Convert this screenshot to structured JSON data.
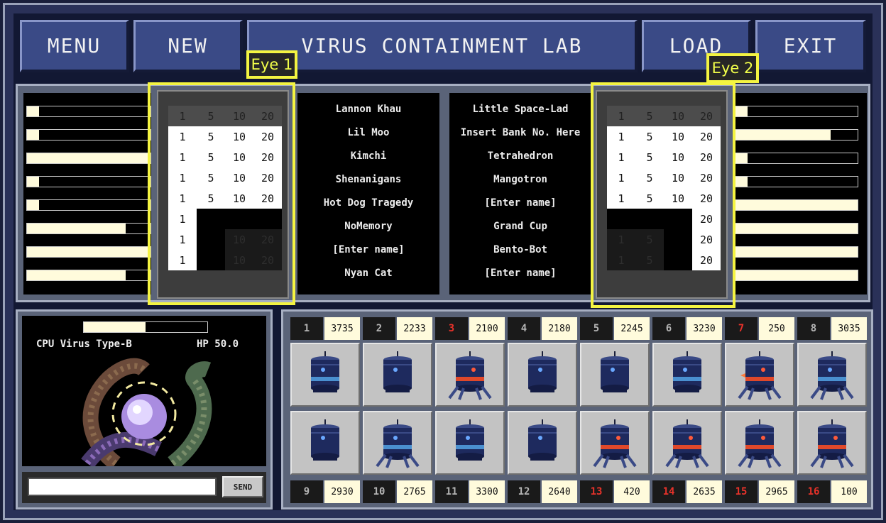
{
  "toolbar": {
    "menu_label": "MENU",
    "new_label": "NEW",
    "title": "VIRUS CONTAINMENT LAB",
    "load_label": "LOAD",
    "exit_label": "EXIT"
  },
  "annotations": {
    "eye1": "Eye 1",
    "eye2": "Eye 2"
  },
  "eye1_grid": {
    "header": [
      "1",
      "5",
      "10",
      "20"
    ],
    "rows": [
      [
        "1",
        "5",
        "10",
        "20"
      ],
      [
        "1",
        "5",
        "10",
        "20"
      ],
      [
        "1",
        "5",
        "10",
        "20"
      ],
      [
        "1",
        "5",
        "10",
        "20"
      ],
      [
        "1",
        "",
        "",
        ""
      ],
      [
        "1",
        "",
        "10",
        "20"
      ],
      [
        "1",
        "",
        "10",
        "20"
      ]
    ]
  },
  "eye2_grid": {
    "header": [
      "1",
      "5",
      "10",
      "20"
    ],
    "rows": [
      [
        "1",
        "5",
        "10",
        "20"
      ],
      [
        "1",
        "5",
        "10",
        "20"
      ],
      [
        "1",
        "5",
        "10",
        "20"
      ],
      [
        "1",
        "5",
        "10",
        "20"
      ],
      [
        "",
        "",
        "",
        "20"
      ],
      [
        "1",
        "5",
        "",
        "20"
      ],
      [
        "1",
        "5",
        "",
        "20"
      ]
    ]
  },
  "left_bars": [
    0.1,
    0.1,
    1.0,
    0.1,
    0.1,
    0.8,
    1.0,
    0.8
  ],
  "right_bars": [
    0.1,
    0.78,
    0.1,
    0.1,
    1.0,
    1.0,
    1.0,
    1.0
  ],
  "names_left": [
    "Lannon Khau",
    "Lil Moo",
    "Kimchi",
    "Shenanigans",
    "Hot Dog Tragedy",
    "NoMemory",
    "[Enter name]",
    "Nyan Cat"
  ],
  "names_right": [
    "Little Space-Lad",
    "Insert Bank No. Here",
    "Tetrahedron",
    "Mangotron",
    "[Enter name]",
    "Grand Cup",
    "Bento-Bot",
    "[Enter name]"
  ],
  "virus": {
    "name": "CPU Virus Type-B",
    "hp_label": "HP 50.0",
    "hp_fraction": 0.5
  },
  "chat": {
    "input_value": "",
    "send_label": "SEND"
  },
  "scores_top": [
    {
      "num": "1",
      "value": "3735",
      "red": false
    },
    {
      "num": "2",
      "value": "2233",
      "red": false
    },
    {
      "num": "3",
      "value": "2100",
      "red": true
    },
    {
      "num": "4",
      "value": "2180",
      "red": false
    },
    {
      "num": "5",
      "value": "2245",
      "red": false
    },
    {
      "num": "6",
      "value": "3230",
      "red": false
    },
    {
      "num": "7",
      "value": "250",
      "red": true
    },
    {
      "num": "8",
      "value": "3035",
      "red": false
    }
  ],
  "scores_bottom": [
    {
      "num": "9",
      "value": "2930",
      "red": false
    },
    {
      "num": "10",
      "value": "2765",
      "red": false
    },
    {
      "num": "11",
      "value": "3300",
      "red": false
    },
    {
      "num": "12",
      "value": "2640",
      "red": false
    },
    {
      "num": "13",
      "value": "420",
      "red": true
    },
    {
      "num": "14",
      "value": "2635",
      "red": true
    },
    {
      "num": "15",
      "value": "2965",
      "red": true
    },
    {
      "num": "16",
      "value": "100",
      "red": true
    }
  ],
  "robots_top": [
    "blue-band",
    "blue",
    "red-band-legs",
    "blue",
    "blue",
    "blue-band",
    "red-band-legs-fire",
    "blue-band-legs"
  ],
  "robots_bottom": [
    "blue",
    "blue-band-legs",
    "blue-band",
    "blue",
    "red-band-legs",
    "red-band-legs",
    "red-band-legs",
    "red-band-legs"
  ],
  "colors": {
    "accent_yellow": "#f4f441",
    "button_blue": "#3a4a86",
    "cream": "#fffbdc",
    "alert_red": "#e8322a"
  }
}
